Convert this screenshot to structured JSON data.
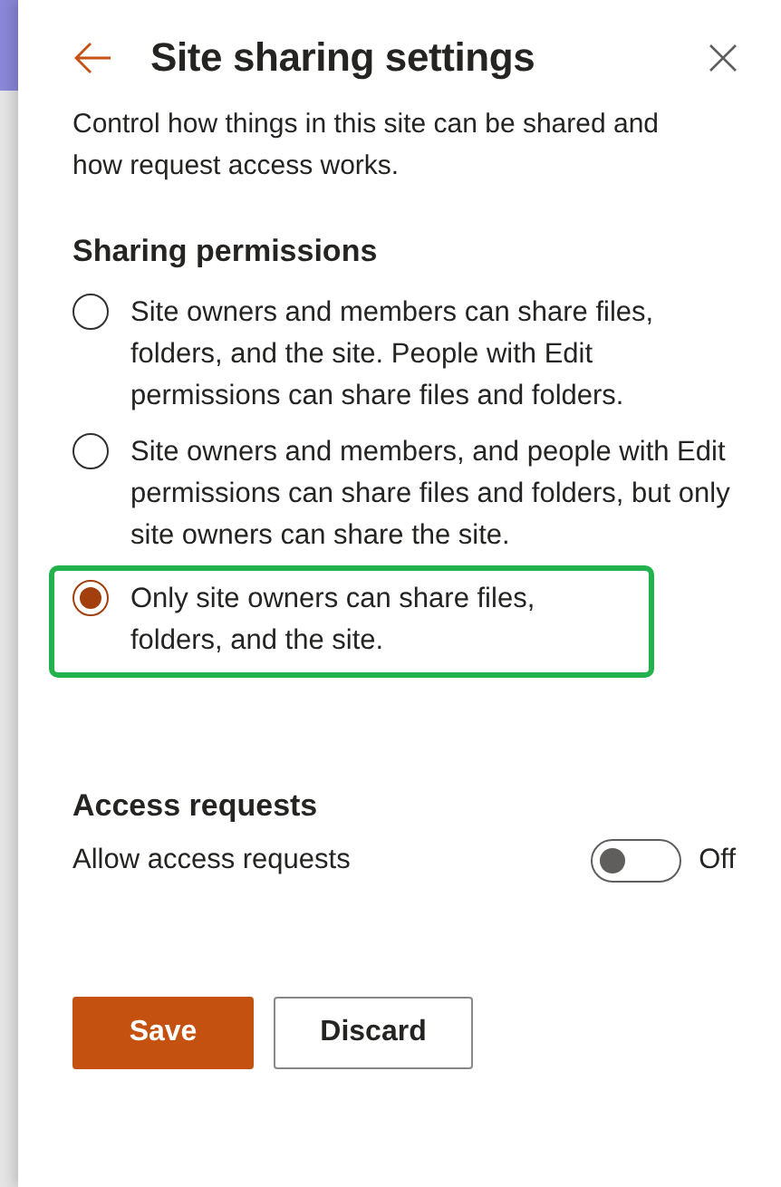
{
  "panel": {
    "title": "Site sharing settings",
    "description": "Control how things in this site can be shared and how request access works."
  },
  "sharing_permissions": {
    "heading": "Sharing permissions",
    "options": [
      {
        "label": "Site owners and members can share files, folders, and the site. People with Edit permissions can share files and folders.",
        "selected": false,
        "highlighted": false
      },
      {
        "label": "Site owners and members, and people with Edit permissions can share files and folders, but only site owners can share the site.",
        "selected": false,
        "highlighted": false
      },
      {
        "label": "Only site owners can share files, folders, and the site.",
        "selected": true,
        "highlighted": true
      }
    ]
  },
  "access_requests": {
    "heading": "Access requests",
    "toggle": {
      "label": "Allow access requests",
      "on": false,
      "state_text": "Off"
    }
  },
  "buttons": [
    {
      "label": "Save",
      "kind": "primary"
    },
    {
      "label": "Discard",
      "kind": "secondary"
    }
  ]
}
